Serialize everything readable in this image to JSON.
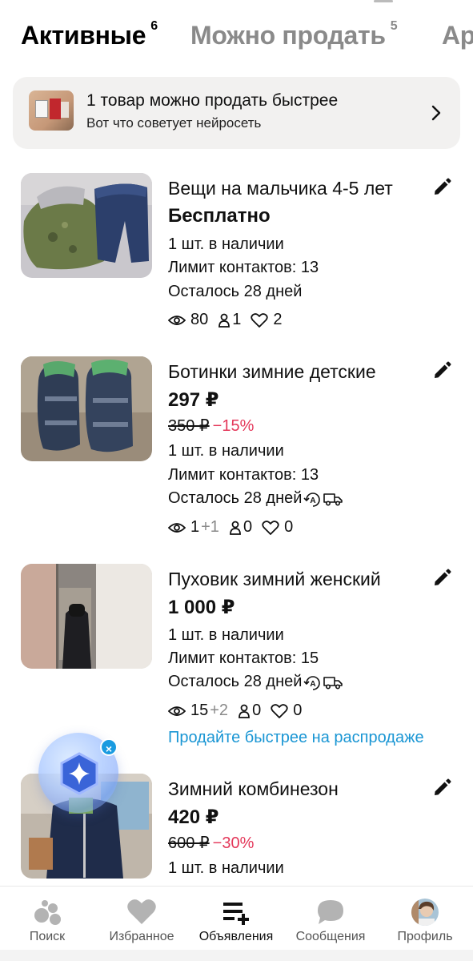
{
  "tabs": [
    {
      "label": "Активные",
      "count": "6"
    },
    {
      "label": "Можно продать",
      "count": "5"
    },
    {
      "label": "Ар",
      "count": ""
    }
  ],
  "banner": {
    "title": "1 товар можно продать быстрее",
    "subtitle": "Вот что советует нейросеть"
  },
  "items": [
    {
      "title": "Вещи на мальчика 4-5 лет",
      "price": "Бесплатно",
      "stock": "1 шт. в наличии",
      "limit": "Лимит контактов: 13",
      "remaining": "Осталось 28 дней",
      "views": "80",
      "contacts": "1",
      "favorites": "2"
    },
    {
      "title": "Ботинки зимние детские",
      "price": "297 ₽",
      "old_price": "350 ₽",
      "discount": "−15%",
      "stock": "1 шт. в наличии",
      "limit": "Лимит контактов: 13",
      "remaining": "Осталось 28 дней",
      "views": "1",
      "views_plus": "+1",
      "contacts": "0",
      "favorites": "0"
    },
    {
      "title": "Пуховик зимний женский",
      "price": "1 000 ₽",
      "stock": "1 шт. в наличии",
      "limit": "Лимит контактов: 15",
      "remaining": "Осталось 28 дней",
      "views": "15",
      "views_plus": "+2",
      "contacts": "0",
      "favorites": "0",
      "promo_link": "Продайте быстрее на распродаже"
    },
    {
      "title": "Зимний комбинезон",
      "price": "420 ₽",
      "old_price": "600 ₽",
      "discount": "−30%",
      "stock": "1 шт. в наличии"
    }
  ],
  "assistant": {
    "close_symbol": "×"
  },
  "bottom_nav": [
    {
      "label": "Поиск",
      "icon": "search-dots-icon"
    },
    {
      "label": "Избранное",
      "icon": "heart-icon"
    },
    {
      "label": "Объявления",
      "icon": "listings-add-icon"
    },
    {
      "label": "Сообщения",
      "icon": "chat-bubble-icon"
    },
    {
      "label": "Профиль",
      "icon": "avatar"
    }
  ],
  "colors": {
    "accent_link": "#1a96d4",
    "discount": "#e4385a",
    "banner_bg": "#f2f1f0",
    "assistant_close": "#1a9be0"
  }
}
